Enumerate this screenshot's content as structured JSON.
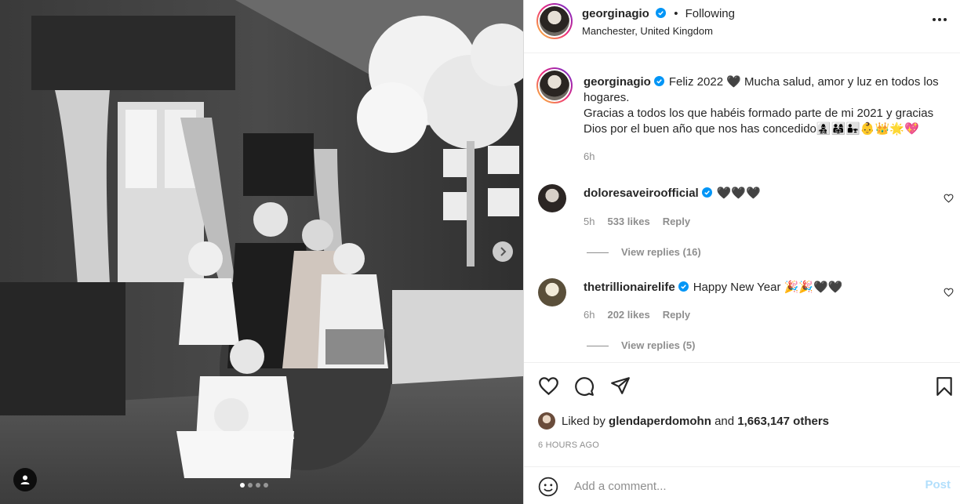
{
  "post": {
    "username": "georginagio",
    "follow_status": "Following",
    "separator": "•",
    "location": "Manchester, United Kingdom"
  },
  "caption": {
    "username": "georginagio",
    "text": "Feliz 2022 🖤 Mucha salud, amor y luz en todos los hogares.\nGracias a todos los que habéis formado parte de mi 2021 y gracias Dios por el buen año que nos has concedido👩‍👧‍👦👨‍👩‍👧👨‍👧👶👑🌟💖",
    "time": "6h"
  },
  "comments": [
    {
      "username": "doloresaveiroofficial",
      "text": "🖤🖤🖤",
      "time": "5h",
      "likes": "533 likes",
      "reply_label": "Reply",
      "view_replies": "View replies (16)"
    },
    {
      "username": "thetrillionairelife",
      "text": "Happy New Year 🎉🎉🖤🖤",
      "time": "6h",
      "likes": "202 likes",
      "reply_label": "Reply",
      "view_replies": "View replies (5)"
    }
  ],
  "likes": {
    "prefix": "Liked by",
    "user": "glendaperdomohn",
    "conjunction": "and",
    "others": "1,663,147 others"
  },
  "timestamp": "6 HOURS AGO",
  "comment_box": {
    "placeholder": "Add a comment...",
    "post_label": "Post"
  },
  "colors": {
    "verified": "#0095f6",
    "muted_text": "#8e8e8e",
    "post_button_disabled": "#b2dffc"
  },
  "icons": {
    "more": "more-horizontal-icon",
    "like": "heart-icon",
    "comment": "comment-icon",
    "share": "send-icon",
    "save": "bookmark-icon",
    "emoji": "emoji-icon",
    "tag": "user-tag-icon",
    "next": "chevron-right-icon"
  },
  "carousel": {
    "count": 4,
    "active_index": 0
  }
}
